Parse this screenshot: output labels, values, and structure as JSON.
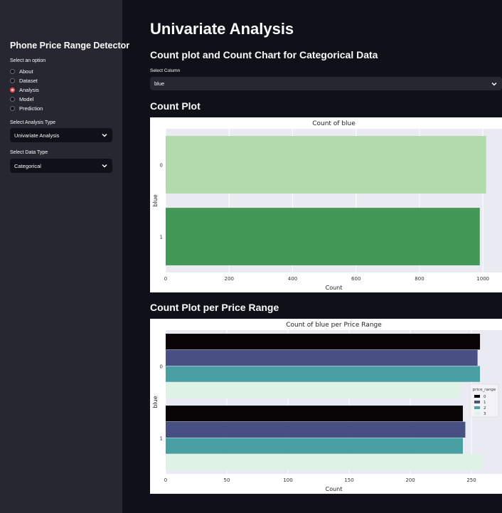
{
  "sidebar": {
    "title": "Phone Price Range Detector",
    "option_label": "Select an option",
    "options": [
      "About",
      "Dataset",
      "Analysis",
      "Model",
      "Prediction"
    ],
    "selected_option": "Analysis",
    "analysis_type_label": "Select Analysis Type",
    "analysis_type_value": "Univariate Analysis",
    "data_type_label": "Select Data Type",
    "data_type_value": "Categorical"
  },
  "main": {
    "title": "Univariate Analysis",
    "subtitle": "Count plot and Count Chart for Categorical Data",
    "column_label": "Select Column",
    "column_value": "blue",
    "count_plot_heading": "Count Plot",
    "per_range_heading": "Count Plot per Price Range"
  },
  "icons": {
    "dropdown": "chevron-down-icon"
  },
  "colors": {
    "accent": "#ff4b4b",
    "bar_0": "#b2dbab",
    "bar_1": "#439858",
    "range_0": "#090406",
    "range_1": "#474f83",
    "range_2": "#479fa1",
    "range_3": "#def2e6",
    "plot_bg": "#eaeaf2"
  },
  "chart_data": [
    {
      "type": "bar",
      "orientation": "horizontal",
      "title": "Count of blue",
      "xlabel": "Count",
      "ylabel": "blue",
      "categories": [
        "0",
        "1"
      ],
      "values": [
        1010,
        990
      ],
      "xlim": [
        0,
        1060
      ],
      "xticks": [
        0,
        200,
        400,
        600,
        800,
        1000
      ],
      "grid": true
    },
    {
      "type": "bar",
      "orientation": "horizontal",
      "title": "Count of blue per Price Range",
      "xlabel": "Count",
      "ylabel": "blue",
      "categories": [
        "0",
        "1"
      ],
      "legend_title": "price_range",
      "legend_position": "right",
      "series": [
        {
          "name": "0",
          "values": [
            257,
            243
          ]
        },
        {
          "name": "1",
          "values": [
            255,
            245
          ]
        },
        {
          "name": "2",
          "values": [
            257,
            243
          ]
        },
        {
          "name": "3",
          "values": [
            241,
            259
          ]
        }
      ],
      "xlim": [
        0,
        275
      ],
      "xticks": [
        0,
        50,
        100,
        150,
        200,
        250
      ],
      "grid": true
    }
  ]
}
